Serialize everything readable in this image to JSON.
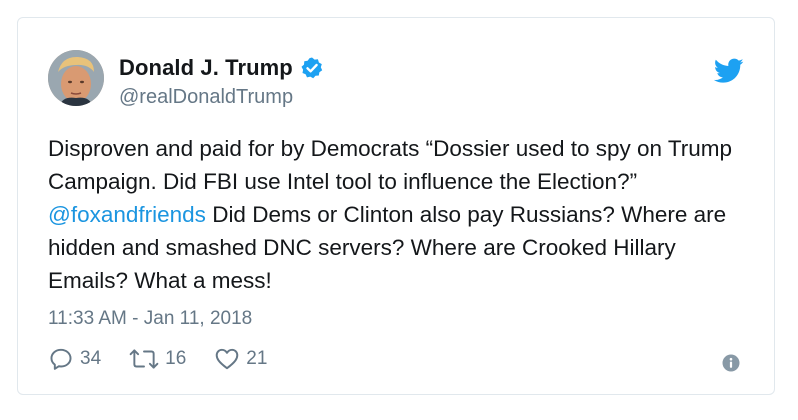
{
  "author": {
    "display_name": "Donald J. Trump",
    "handle": "@realDonaldTrump",
    "verified": true,
    "avatar": "profile-photo"
  },
  "tweet": {
    "text_before_mention": "Disproven and paid for by Democrats “Dossier used to spy on Trump Campaign. Did FBI use Intel tool to influence the Election?” ",
    "mention": "@foxandfriends",
    "text_after_mention": "  Did Dems or Clinton also pay Russians? Where are hidden and smashed DNC servers? Where are Crooked Hillary Emails?  What a mess!",
    "timestamp": "11:33 AM - Jan 11, 2018"
  },
  "actions": {
    "replies": "34",
    "retweets": "16",
    "likes": "21"
  },
  "icons": {
    "brand": "twitter-bird-icon",
    "verified": "verified-badge-icon",
    "reply": "reply-icon",
    "retweet": "retweet-icon",
    "like": "heart-icon",
    "info": "info-icon"
  },
  "colors": {
    "brand_blue": "#1da1f2",
    "mention_blue": "#1b95e0",
    "secondary_text": "#657786",
    "primary_text": "#14171a",
    "border": "#e1e8ed"
  }
}
